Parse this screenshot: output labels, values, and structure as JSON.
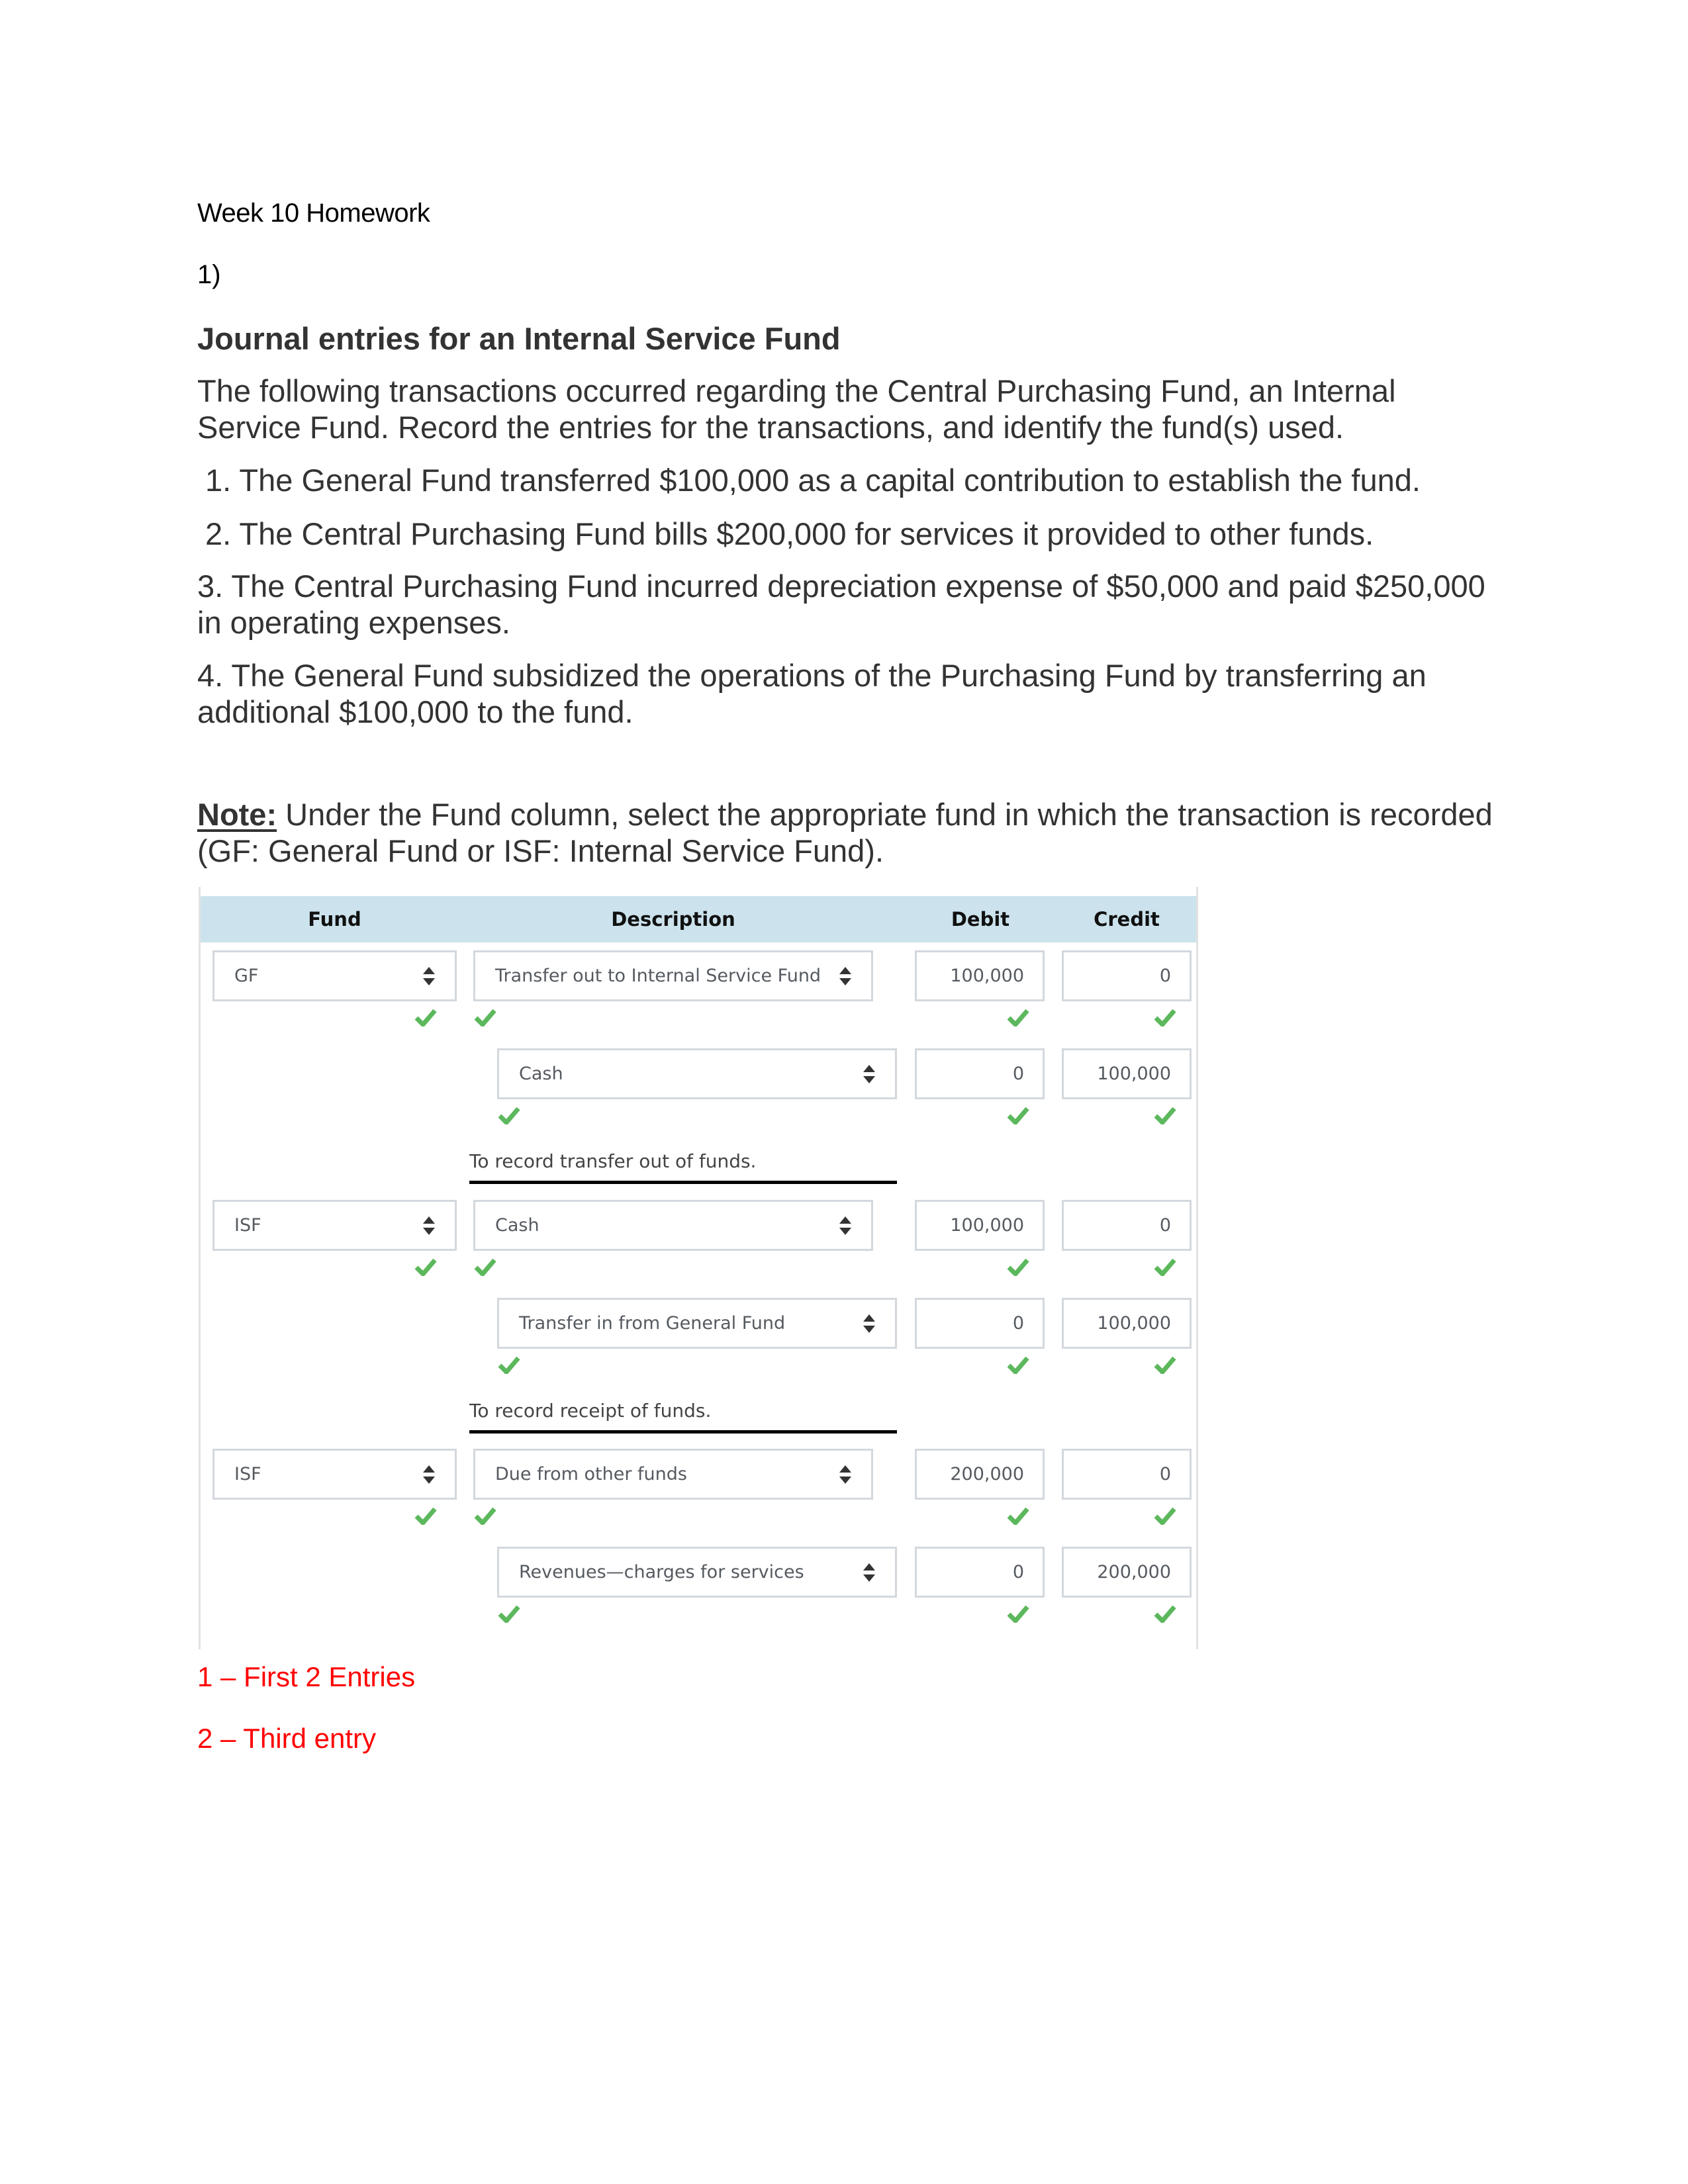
{
  "document": {
    "title": "Week 10 Homework",
    "question_number": "1)",
    "heading": "Journal entries for an Internal Service Fund",
    "intro": "The following transactions occurred regarding the Central Purchasing Fund, an Internal Service Fund. Record the entries for the transactions, and identify the fund(s) used.",
    "transactions": [
      "1. The General Fund transferred $100,000 as a capital contribution to establish the fund.",
      "2. The Central Purchasing Fund bills $200,000 for services it provided to other funds.",
      "3. The Central Purchasing Fund incurred depreciation expense of $50,000 and paid $250,000 in operating expenses.",
      "4. The General Fund subsidized the operations of the Purchasing Fund by transferring an additional $100,000 to the fund."
    ],
    "note_label": "Note:",
    "note_text": " Under the Fund column, select the appropriate fund in which the transaction is recorded (GF: General Fund or ISF: Internal Service Fund).",
    "annotations": [
      "1 – First 2 Entries",
      "2 – Third entry"
    ],
    "annotation_color": "#ff0000"
  },
  "journal": {
    "headers": {
      "fund": "Fund",
      "description": "Description",
      "debit": "Debit",
      "credit": "Credit"
    },
    "header_bg": "#cce3ed",
    "check_color": "#5cb85c",
    "entries": [
      {
        "fund": "GF",
        "lines": [
          {
            "description": "Transfer out to Internal Service Fund",
            "debit": "100,000",
            "credit": "0"
          },
          {
            "description": "Cash",
            "debit": "0",
            "credit": "100,000"
          }
        ],
        "memo": "To record transfer out of funds."
      },
      {
        "fund": "ISF",
        "lines": [
          {
            "description": "Cash",
            "debit": "100,000",
            "credit": "0"
          },
          {
            "description": "Transfer in from General Fund",
            "debit": "0",
            "credit": "100,000"
          }
        ],
        "memo": "To record receipt of funds."
      },
      {
        "fund": "ISF",
        "lines": [
          {
            "description": "Due from other funds",
            "debit": "200,000",
            "credit": "0"
          },
          {
            "description": "Revenues—charges for services",
            "debit": "0",
            "credit": "200,000"
          }
        ],
        "memo": ""
      }
    ]
  }
}
